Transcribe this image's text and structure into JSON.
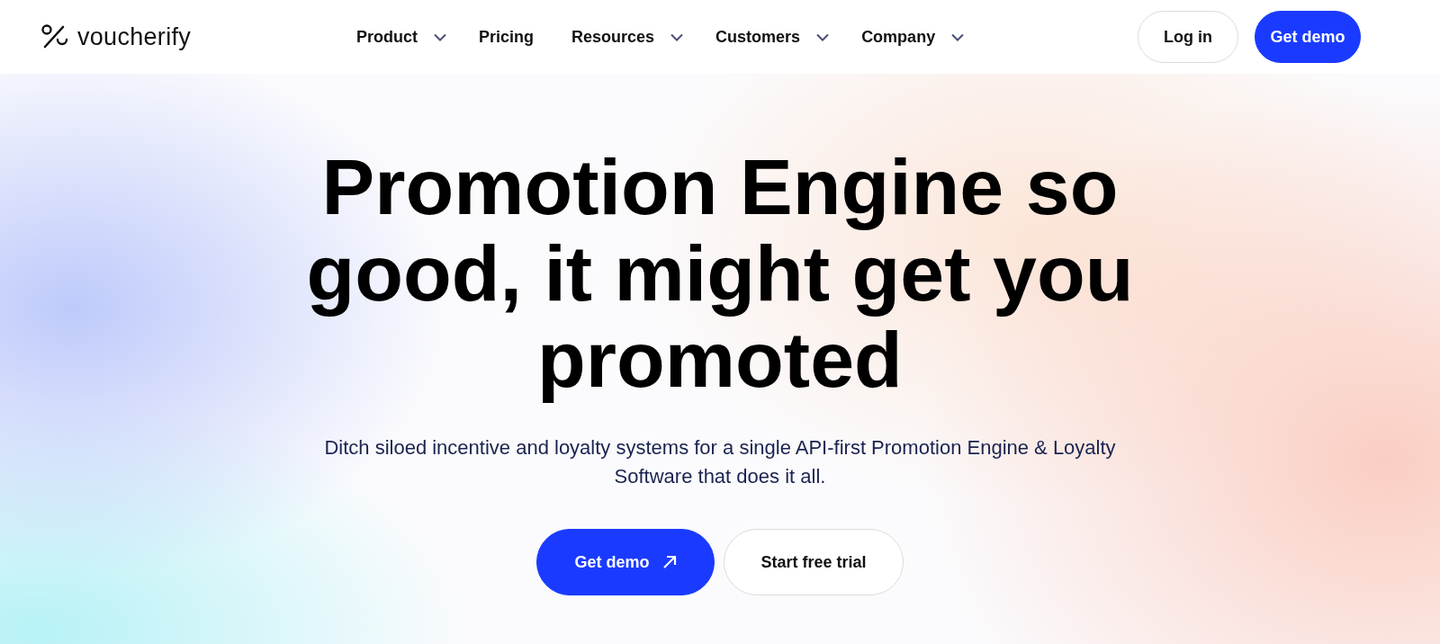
{
  "header": {
    "logo": "voucherify",
    "nav": [
      {
        "label": "Product",
        "has_dropdown": true
      },
      {
        "label": "Pricing",
        "has_dropdown": false
      },
      {
        "label": "Resources",
        "has_dropdown": true
      },
      {
        "label": "Customers",
        "has_dropdown": true
      },
      {
        "label": "Company",
        "has_dropdown": true
      }
    ],
    "login": "Log in",
    "demo": "Get demo"
  },
  "hero": {
    "headline": "Promotion Engine so good, it might get you promoted",
    "subtitle": "Ditch siloed incentive and loyalty systems for a single API-first Promotion Engine & Loyalty Software that does it all.",
    "buttons": [
      {
        "label": "Get demo",
        "kind": "primary"
      },
      {
        "label": "Start free trial",
        "kind": "secondary"
      }
    ]
  }
}
